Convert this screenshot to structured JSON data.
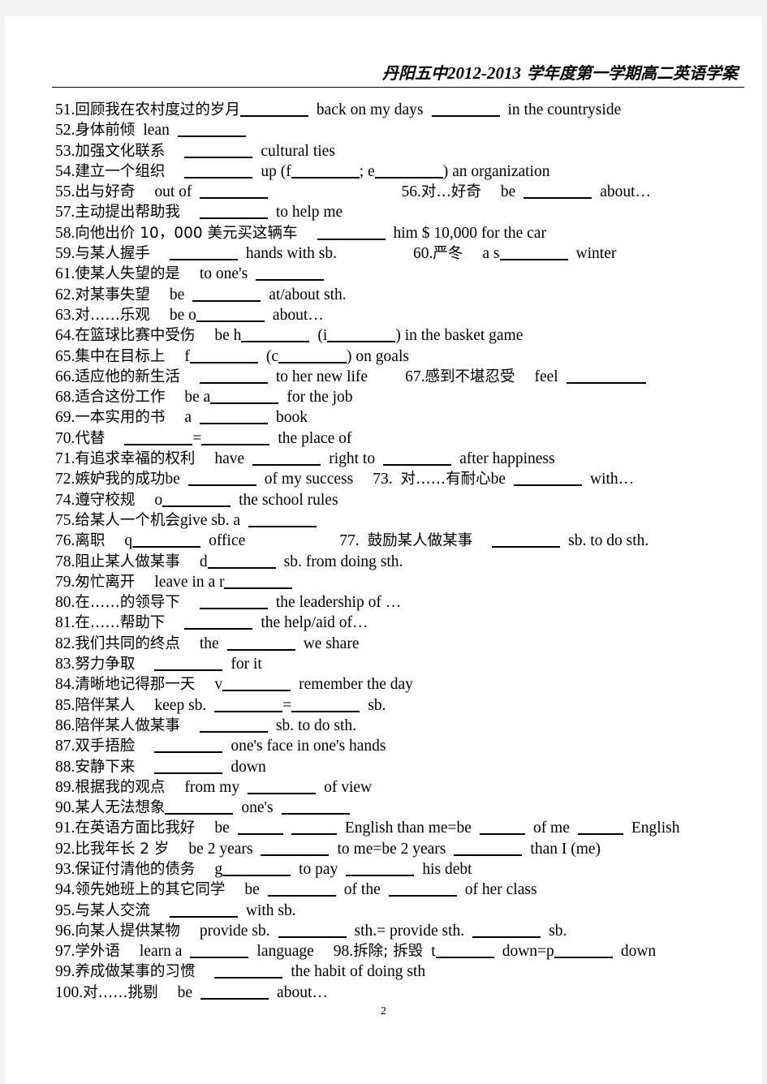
{
  "document": {
    "header": {
      "school": "丹阳五中",
      "years": "2012-2013",
      "rest": " 学年度第一学期高二英语学案",
      "full": "丹阳五中2012-2013 学年度第一学期高二英语学案"
    },
    "page_number": "2",
    "lines": [
      {
        "num": "51.",
        "cn": "回顾我在农村度过的岁月",
        "en": " back on my days  in the countryside",
        "raw": "51.回顾我在农村度过的岁月________ back on my days ________ in the countryside"
      },
      {
        "num": "52.",
        "cn": "身体前倾",
        "en": "lean ________",
        "raw": "52.身体前倾 lean ________"
      },
      {
        "num": "53.",
        "cn": "加强文化联系",
        "en": "________ cultural ties",
        "raw": "53.加强文化联系 ________ cultural ties"
      },
      {
        "num": "54.",
        "cn": "建立一个组织",
        "en": "________ up (f________; e________) an organization",
        "raw": "54.建立一个组织 ________ up (f________; e________) an organization"
      },
      {
        "num": "55.",
        "cn": "出与好奇",
        "en": "out of ________",
        "raw": "55.出与好奇 out of ________"
      },
      {
        "num": "56.",
        "cn": "对…好奇",
        "en": "be ________ about…",
        "raw": "56.对…好奇 be ________ about…"
      },
      {
        "num": "57.",
        "cn": "主动提出帮助我",
        "en": "________ to help me",
        "raw": "57.主动提出帮助我 ________ to help me"
      },
      {
        "num": "58.",
        "cn": "向他出价 10，000 美元买这辆车",
        "en": "________ him $ 10,000 for the car",
        "raw": "58.向他出价 10，000 美元买这辆车 ________ him $ 10,000 for the car"
      },
      {
        "num": "59.",
        "cn": "与某人握手",
        "en": "________ hands with sb.",
        "raw": "59.与某人握手 ________ hands with sb."
      },
      {
        "num": "60.",
        "cn": "严冬",
        "en": "a s________ winter",
        "raw": "60.严冬 a s________ winter"
      },
      {
        "num": "61.",
        "cn": "使某人失望的是",
        "en": "to one's ________",
        "raw": "61.使某人失望的是 to one's ________"
      },
      {
        "num": "62.",
        "cn": "对某事失望",
        "en": "be ________ at/about sth.",
        "raw": "62.对某事失望 be ________ at/about sth."
      },
      {
        "num": "63.",
        "cn": "对……乐观",
        "en": "be o________ about…",
        "raw": "63.对……乐观 be o________ about…"
      },
      {
        "num": "64.",
        "cn": "在篮球比赛中受伤",
        "en": "be h________ (i________) in the basket game",
        "raw": "64.在篮球比赛中受伤 be h________ (i________) in the basket game"
      },
      {
        "num": "65.",
        "cn": "集中在目标上",
        "en": "f________ (c________) on goals",
        "raw": "65.集中在目标上 f________ (c________) on goals"
      },
      {
        "num": "66.",
        "cn": "适应他的新生活",
        "en": "________ to her new life",
        "raw": "66.适应他的新生活 ________ to her new life"
      },
      {
        "num": "67.",
        "cn": "感到不堪忍受",
        "en": "feel ________",
        "raw": "67.感到不堪忍受 feel ________"
      },
      {
        "num": "68.",
        "cn": "适合这份工作",
        "en": "be a________ for the job",
        "raw": "68.适合这份工作 be a________ for the job"
      },
      {
        "num": "69.",
        "cn": "一本实用的书",
        "en": "a ________ book",
        "raw": "69.一本实用的书 a ________ book"
      },
      {
        "num": "70.",
        "cn": "代替",
        "en": "________=________ the place of",
        "raw": "70.代替 ________=________ the place of"
      },
      {
        "num": "71.",
        "cn": "有追求幸福的权利",
        "en": "have ________ right to ________ after happiness",
        "raw": "71.有追求幸福的权利 have ________ right to ________ after happiness"
      },
      {
        "num": "72.",
        "cn": "嫉妒我的成功",
        "en": "be ________ of my success",
        "raw": "72.嫉妒我的成功 be ________ of my success"
      },
      {
        "num": "73.",
        "cn": "对……有耐心",
        "en": "be ________ with…",
        "raw": "73. 对……有耐心 be ________ with…"
      },
      {
        "num": "74.",
        "cn": "遵守校规",
        "en": "o________ the school rules",
        "raw": "74.遵守校规 o________ the school rules"
      },
      {
        "num": "75.",
        "cn": "给某人一个机会",
        "en": "give sb. a ________",
        "raw": "75.给某人一个机会 give sb. a ________"
      },
      {
        "num": "76.",
        "cn": "离职",
        "en": "q________ office",
        "raw": "76.离职 q________ office"
      },
      {
        "num": "77.",
        "cn": "鼓励某人做某事",
        "en": "________ sb. to do sth.",
        "raw": "77. 鼓励某人做某事 ________ sb. to do sth."
      },
      {
        "num": "78.",
        "cn": "阻止某人做某事",
        "en": "d________ sb. from doing sth.",
        "raw": "78.阻止某人做某事 d________ sb. from doing sth."
      },
      {
        "num": "79.",
        "cn": "匆忙离开",
        "en": "leave in a r________",
        "raw": "79.匆忙离开 leave in a r________"
      },
      {
        "num": "80.",
        "cn": "在……的领导下",
        "en": "________ the leadership of …",
        "raw": "80.在……的领导下 ________ the leadership of …"
      },
      {
        "num": "81.",
        "cn": "在……帮助下",
        "en": "________ the help/aid of…",
        "raw": "81.在……帮助下 ________ the help/aid of…"
      },
      {
        "num": "82.",
        "cn": "我们共同的终点",
        "en": "the ________ we share",
        "raw": "82.我们共同的终点 the ________ we share"
      },
      {
        "num": "83.",
        "cn": "努力争取",
        "en": "________ for it",
        "raw": "83.努力争取 ________ for it"
      },
      {
        "num": "84.",
        "cn": "清晰地记得那一天",
        "en": "v________ remember the day",
        "raw": "84.清晰地记得那一天 v________ remember the day"
      },
      {
        "num": "85.",
        "cn": "陪伴某人",
        "en": "keep sb. ________=________ sb.",
        "raw": "85.陪伴某人 keep sb. ________=________ sb."
      },
      {
        "num": "86.",
        "cn": "陪伴某人做某事",
        "en": "________ sb. to do sth.",
        "raw": "86.陪伴某人做某事 ________ sb. to do sth."
      },
      {
        "num": "87.",
        "cn": "双手捂脸",
        "en": "________ one's face in one's hands",
        "raw": "87.双手捂脸 ________ one's face in one's hands"
      },
      {
        "num": "88.",
        "cn": "安静下来",
        "en": "________ down",
        "raw": "88.安静下来 ________ down"
      },
      {
        "num": "89.",
        "cn": "根据我的观点",
        "en": "from my ________ of view",
        "raw": "89.根据我的观点 from my ________ of view"
      },
      {
        "num": "90.",
        "cn": "某人无法想象",
        "en": "________ one's ________",
        "raw": "90.某人无法想象________ one's ________"
      },
      {
        "num": "91.",
        "cn": "在英语方面比我好",
        "en": "be ____ ____ English than me=be ____ of me ____ English",
        "raw": "91.在英语方面比我好 be ____ ____ English than me=be ____ of me ____ English"
      },
      {
        "num": "92.",
        "cn": "比我年长 2 岁",
        "en": "be 2 years ________ to me=be 2 years ________ than I (me)",
        "raw": "92.比我年长 2 岁 be 2 years ________ to me=be 2 years ________ than I (me)"
      },
      {
        "num": "93.",
        "cn": "保证付清他的债务",
        "en": "g________ to pay ________ his debt",
        "raw": "93.保证付清他的债务 g________ to pay ________ his debt"
      },
      {
        "num": "94.",
        "cn": "领先她班上的其它同学",
        "en": "be ________ of the ________ of her class",
        "raw": "94.领先她班上的其它同学 be ________ of the ________ of her class"
      },
      {
        "num": "95.",
        "cn": "与某人交流",
        "en": "________ with sb.",
        "raw": "95.与某人交流 ________ with sb."
      },
      {
        "num": "96.",
        "cn": "向某人提供某物",
        "en": "provide sb. ________ sth.= provide sth. ________ sb.",
        "raw": "96.向某人提供某物 provide sb. ________ sth.= provide sth. ________ sb."
      },
      {
        "num": "97.",
        "cn": "学外语",
        "en": "learn a ________ language",
        "raw": "97.学外语 learn a ________ language"
      },
      {
        "num": "98.",
        "cn": "拆除; 拆毁",
        "en": "t________ down=p________ down",
        "raw": "98.拆除;拆毁 t________ down=p________ down"
      },
      {
        "num": "99.",
        "cn": "养成做某事的习惯",
        "en": "________ the habit of doing sth",
        "raw": "99.养成做某事的习惯 ________ the habit of doing sth"
      },
      {
        "num": "100.",
        "cn": "对……挑剔",
        "en": "be ________ about…",
        "raw": "100.对……挑剔 be ________ about…"
      }
    ],
    "line_fragments": {
      "l51": {
        "a": "back on my days",
        "b": "in the countryside"
      },
      "l52": {
        "a": "lean"
      },
      "l53": {
        "a": "cultural ties"
      },
      "l54": {
        "a": "up (f",
        "b": "; e",
        "c": ") an organization"
      },
      "l55": {
        "a": "out of"
      },
      "l56": {
        "a": "be",
        "b": "about…"
      },
      "l57": {
        "a": "to help me"
      },
      "l58": {
        "a": "him $ 10,000 for the car"
      },
      "l59": {
        "a": "hands with sb."
      },
      "l60": {
        "a": "a s",
        "b": "winter"
      },
      "l61": {
        "a": "to one's"
      },
      "l62": {
        "a": "be",
        "b": "at/about sth."
      },
      "l63": {
        "a": "be o",
        "b": "about…"
      },
      "l64": {
        "a": "be h",
        "b": "(i",
        "c": ") in the basket game"
      },
      "l65": {
        "a": "f",
        "b": "(c",
        "c": ") on goals"
      },
      "l66": {
        "a": "to her new life"
      },
      "l67": {
        "a": "feel"
      },
      "l68": {
        "a": "be a",
        "b": "for the job"
      },
      "l69": {
        "a": "a",
        "b": "book"
      },
      "l70": {
        "a": "=",
        "b": "the place of"
      },
      "l71": {
        "a": "have",
        "b": "right to",
        "c": "after happiness"
      },
      "l72": {
        "a": "be",
        "b": "of my success"
      },
      "l73": {
        "a": "be",
        "b": "with…"
      },
      "l74": {
        "a": "o",
        "b": "the school rules"
      },
      "l75": {
        "a": "give sb. a"
      },
      "l76": {
        "a": "q",
        "b": "office"
      },
      "l77": {
        "a": "sb. to do sth."
      },
      "l78": {
        "a": "d",
        "b": "sb. from doing sth."
      },
      "l79": {
        "a": "leave in a r"
      },
      "l80": {
        "a": "the leadership of …"
      },
      "l81": {
        "a": "the help/aid of…"
      },
      "l82": {
        "a": "the",
        "b": "we share"
      },
      "l83": {
        "a": "for it"
      },
      "l84": {
        "a": "v",
        "b": "remember the day"
      },
      "l85": {
        "a": "keep sb.",
        "b": "=",
        "c": "sb."
      },
      "l86": {
        "a": "sb. to do sth."
      },
      "l87": {
        "a": "one's face in one's hands"
      },
      "l88": {
        "a": "down"
      },
      "l89": {
        "a": "from my",
        "b": "of view"
      },
      "l90": {
        "a": "one's"
      },
      "l91": {
        "a": "be",
        "b": "English than me=be",
        "c": "of me",
        "d": "English"
      },
      "l92": {
        "a": "be 2 years",
        "b": "to me=be 2 years",
        "c": "than I (me)"
      },
      "l93": {
        "a": "g",
        "b": "to pay",
        "c": "his debt"
      },
      "l94": {
        "a": "be",
        "b": "of the",
        "c": "of her class"
      },
      "l95": {
        "a": "with sb."
      },
      "l96": {
        "a": "provide sb.",
        "b": "sth.= provide sth.",
        "c": "sb."
      },
      "l97": {
        "a": "learn a",
        "b": "language"
      },
      "l98": {
        "a": "t",
        "b": "down=p",
        "c": "down"
      },
      "l99": {
        "a": "the habit of doing sth"
      },
      "l100": {
        "a": "be",
        "b": "about…"
      }
    }
  },
  "colors": {
    "page_background": "#f2f2f2",
    "paper": "#ffffff",
    "text": "#000000",
    "rule": "#000000"
  }
}
